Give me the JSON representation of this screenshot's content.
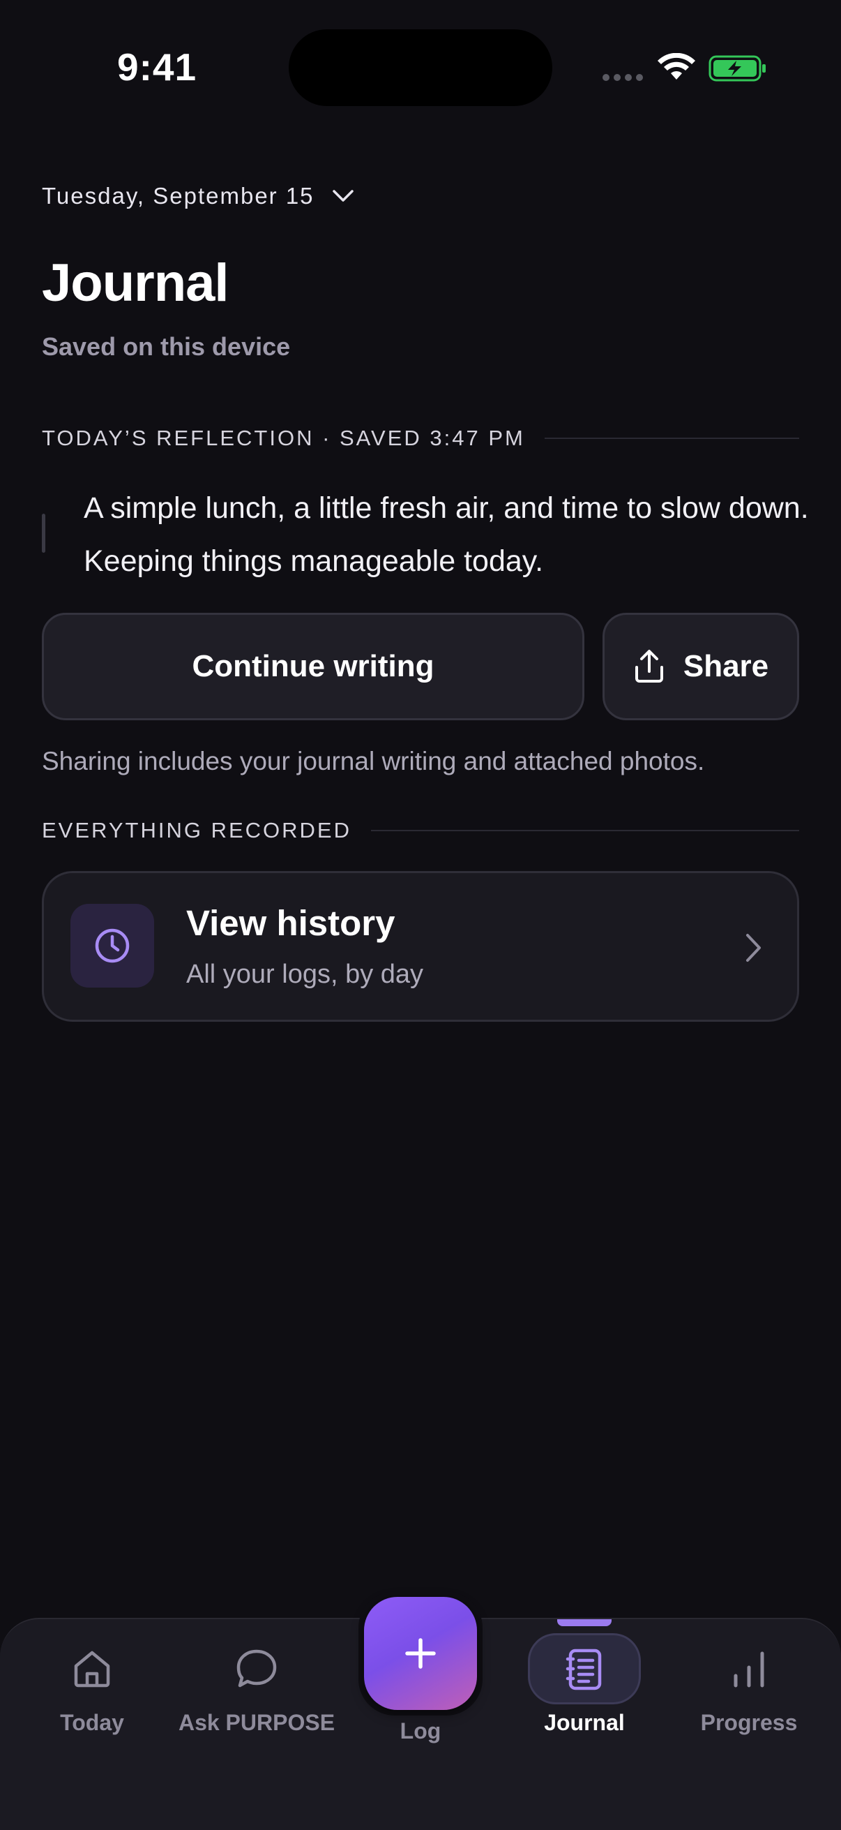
{
  "status_bar": {
    "time": "9:41"
  },
  "header": {
    "date": "Tuesday, September 15",
    "title": "Journal",
    "subtitle": "Saved on this device"
  },
  "reflection": {
    "section_label": "TODAY’S REFLECTION · SAVED 3:47 PM",
    "text": "A simple lunch, a little fresh air, and time to slow down. Keeping things manageable today."
  },
  "actions": {
    "continue_label": "Continue writing",
    "share_label": "Share",
    "share_note": "Sharing includes your journal writing and attached photos."
  },
  "recorded": {
    "section_label": "EVERYTHING RECORDED",
    "history_title": "View history",
    "history_subtitle": "All your logs, by day"
  },
  "tabbar": {
    "today": "Today",
    "ask": "Ask PURPOSE",
    "log": "Log",
    "journal": "Journal",
    "progress": "Progress",
    "active": "Journal"
  },
  "colors": {
    "background": "#0f0e13",
    "accent": "#8e5cf6",
    "accent_secondary": "#c05fb6",
    "battery": "#34c759"
  },
  "icons": [
    "chevron-down-icon",
    "share-icon",
    "clock-icon",
    "chevron-right-icon",
    "home-icon",
    "chat-bubble-icon",
    "plus-icon",
    "journal-icon",
    "bar-chart-icon",
    "wifi-icon",
    "battery-icon"
  ]
}
